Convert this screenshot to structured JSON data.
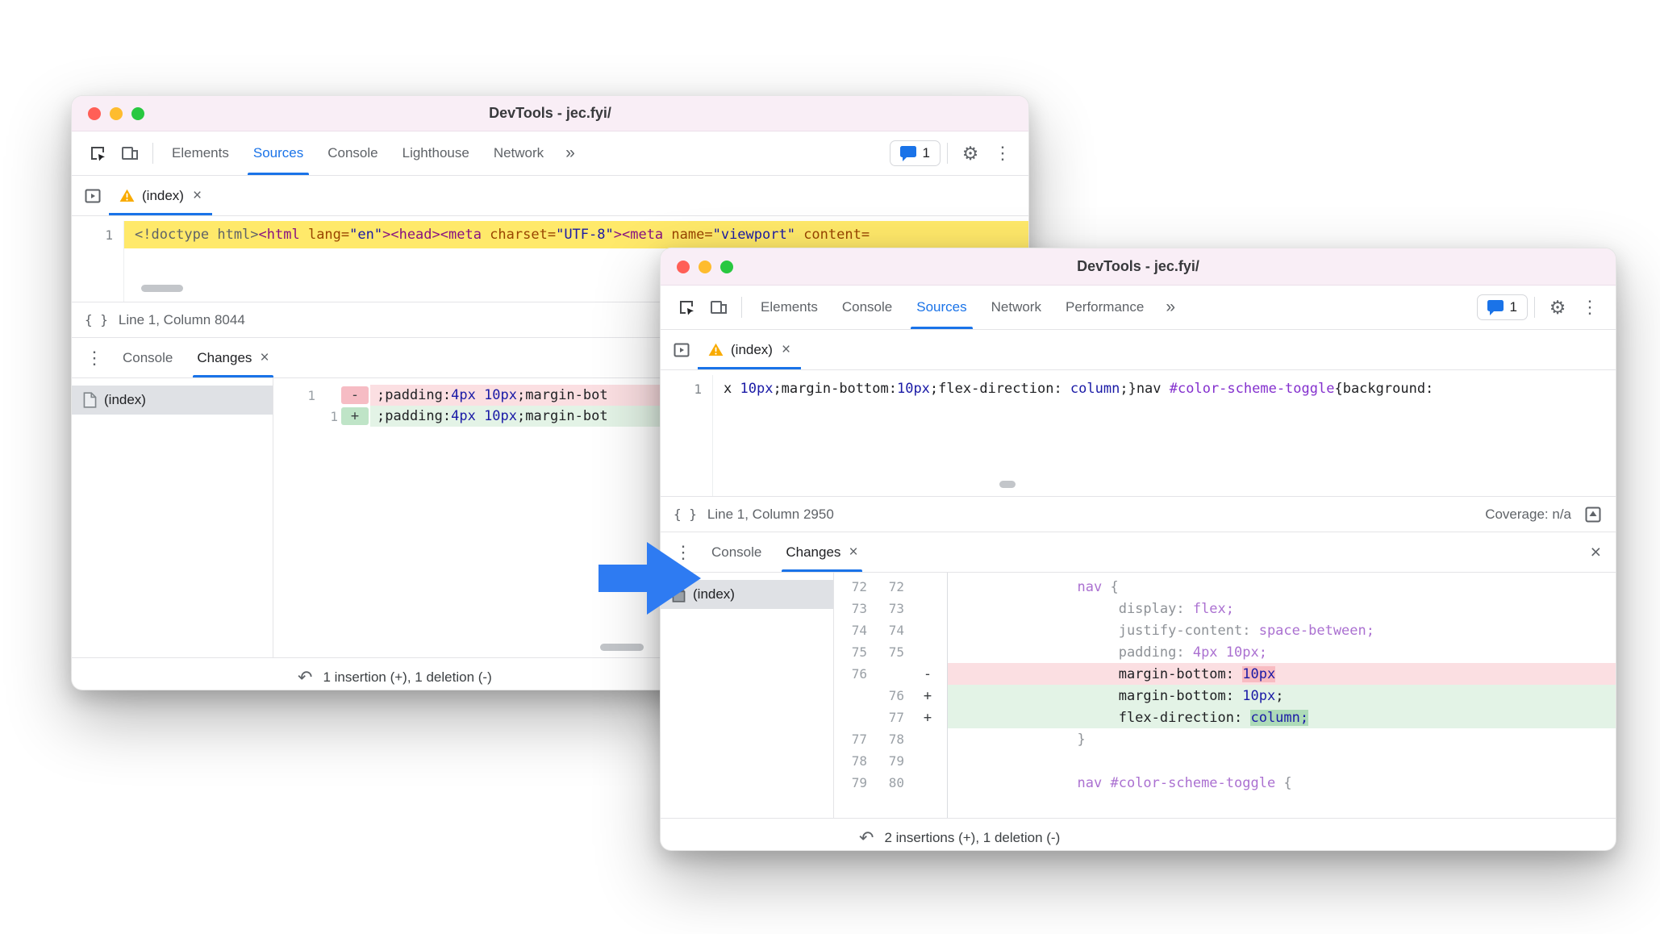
{
  "colors": {
    "accent": "#1a73e8",
    "arrow": "#2e7bf2",
    "highlight_yellow": "#ffe96a"
  },
  "icons": {
    "close": "×",
    "more_tabs": "»",
    "kebab": "⋮",
    "gear": "⚙",
    "revert": "↶",
    "pretty_print": "{ }"
  },
  "back_window": {
    "title": "DevTools - jec.fyi/",
    "toolbar": {
      "tabs": [
        {
          "label": "Elements"
        },
        {
          "label": "Sources"
        },
        {
          "label": "Console"
        },
        {
          "label": "Lighthouse"
        },
        {
          "label": "Network"
        }
      ],
      "badge_count": "1"
    },
    "file_tab": {
      "label": "(index)"
    },
    "editor": {
      "line_number": "1",
      "tokens": [
        {
          "t": "<!doctype html>",
          "c": "doctype"
        },
        {
          "t": "<html",
          "c": "tag"
        },
        {
          "t": " lang=",
          "c": "attr"
        },
        {
          "t": "\"en\"",
          "c": "str"
        },
        {
          "t": ">",
          "c": "tag"
        },
        {
          "t": "<head>",
          "c": "tag"
        },
        {
          "t": "<meta",
          "c": "tag"
        },
        {
          "t": " charset=",
          "c": "attr"
        },
        {
          "t": "\"UTF-8\"",
          "c": "str"
        },
        {
          "t": ">",
          "c": "tag"
        },
        {
          "t": "<meta",
          "c": "tag"
        },
        {
          "t": " name=",
          "c": "attr"
        },
        {
          "t": "\"viewport\"",
          "c": "str"
        },
        {
          "t": " content=",
          "c": "attr"
        }
      ]
    },
    "status": {
      "position": "Line 1, Column 8044"
    },
    "drawer": {
      "console_tab": "Console",
      "changes_tab": "Changes",
      "file": "(index)",
      "diff": [
        {
          "old": "1",
          "new": "",
          "sign": "-",
          "kind": "del",
          "tokens": [
            {
              "t": ";padding:",
              "c": "def"
            },
            {
              "t": "4px 10px",
              "c": "num"
            },
            {
              "t": ";margin-bot",
              "c": "def"
            }
          ]
        },
        {
          "old": "",
          "new": "1",
          "sign": "+",
          "kind": "ins",
          "tokens": [
            {
              "t": ";padding:",
              "c": "def"
            },
            {
              "t": "4px 10px",
              "c": "num"
            },
            {
              "t": ";margin-bot",
              "c": "def"
            }
          ]
        }
      ],
      "summary": "1 insertion (+), 1 deletion (-)"
    }
  },
  "front_window": {
    "title": "DevTools - jec.fyi/",
    "toolbar": {
      "tabs": [
        {
          "label": "Elements"
        },
        {
          "label": "Console"
        },
        {
          "label": "Sources"
        },
        {
          "label": "Network"
        },
        {
          "label": "Performance"
        }
      ],
      "badge_count": "1"
    },
    "file_tab": {
      "label": "(index)"
    },
    "editor": {
      "line_number": "1",
      "tokens": [
        {
          "t": "x ",
          "c": "def"
        },
        {
          "t": "10px",
          "c": "num"
        },
        {
          "t": ";margin-bottom:",
          "c": "def"
        },
        {
          "t": "10px",
          "c": "num"
        },
        {
          "t": ";flex-direction: ",
          "c": "def"
        },
        {
          "t": "column",
          "c": "kw"
        },
        {
          "t": ";}nav ",
          "c": "def"
        },
        {
          "t": "#color-scheme-toggle",
          "c": "id"
        },
        {
          "t": "{background:",
          "c": "def"
        }
      ]
    },
    "status": {
      "position": "Line 1, Column 2950",
      "coverage": "Coverage: n/a"
    },
    "drawer": {
      "console_tab": "Console",
      "changes_tab": "Changes",
      "file": "(index)",
      "diff": [
        {
          "old": "72",
          "new": "72",
          "sign": "",
          "kind": "ctx",
          "tokens": [
            {
              "t": "               ",
              "c": "ctx"
            },
            {
              "t": "nav",
              "c": "ctxsel"
            },
            {
              "t": " {",
              "c": "ctx"
            }
          ]
        },
        {
          "old": "73",
          "new": "73",
          "sign": "",
          "kind": "ctx",
          "tokens": [
            {
              "t": "                    ",
              "c": "ctx"
            },
            {
              "t": "display: ",
              "c": "ctxprop"
            },
            {
              "t": "flex;",
              "c": "ctxval"
            }
          ]
        },
        {
          "old": "74",
          "new": "74",
          "sign": "",
          "kind": "ctx",
          "tokens": [
            {
              "t": "                    ",
              "c": "ctx"
            },
            {
              "t": "justify-content: ",
              "c": "ctxprop"
            },
            {
              "t": "space-between;",
              "c": "ctxval"
            }
          ]
        },
        {
          "old": "75",
          "new": "75",
          "sign": "",
          "kind": "ctx",
          "tokens": [
            {
              "t": "                    ",
              "c": "ctx"
            },
            {
              "t": "padding: ",
              "c": "ctxprop"
            },
            {
              "t": "4px 10px;",
              "c": "ctxval"
            }
          ]
        },
        {
          "old": "76",
          "new": "",
          "sign": "-",
          "kind": "del",
          "tokens": [
            {
              "t": "                    ",
              "c": "def"
            },
            {
              "t": "margin-bottom: ",
              "c": "def"
            },
            {
              "t": "10px",
              "c": "num",
              "hl": "red"
            }
          ]
        },
        {
          "old": "",
          "new": "76",
          "sign": "+",
          "kind": "ins",
          "tokens": [
            {
              "t": "                    ",
              "c": "def"
            },
            {
              "t": "margin-bottom: ",
              "c": "def"
            },
            {
              "t": "10px",
              "c": "num"
            },
            {
              "t": ";",
              "c": "def"
            }
          ]
        },
        {
          "old": "",
          "new": "77",
          "sign": "+",
          "kind": "ins",
          "tokens": [
            {
              "t": "                    ",
              "c": "def"
            },
            {
              "t": "flex-direction: ",
              "c": "def"
            },
            {
              "t": "column;",
              "c": "kw",
              "hl": "green"
            }
          ]
        },
        {
          "old": "77",
          "new": "78",
          "sign": "",
          "kind": "ctx",
          "tokens": [
            {
              "t": "               ",
              "c": "ctx"
            },
            {
              "t": "}",
              "c": "ctx"
            }
          ]
        },
        {
          "old": "78",
          "new": "79",
          "sign": "",
          "kind": "ctx",
          "tokens": []
        },
        {
          "old": "79",
          "new": "80",
          "sign": "",
          "kind": "ctx",
          "tokens": [
            {
              "t": "               ",
              "c": "ctx"
            },
            {
              "t": "nav ",
              "c": "ctxsel"
            },
            {
              "t": "#color-scheme-toggle",
              "c": "ctxsel"
            },
            {
              "t": " {",
              "c": "ctx"
            }
          ]
        }
      ],
      "summary": "2 insertions (+), 1 deletion (-)"
    }
  }
}
